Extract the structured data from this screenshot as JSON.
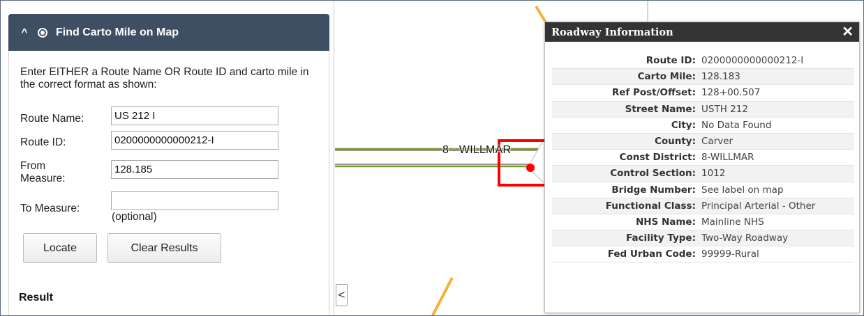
{
  "panel": {
    "title": "Find Carto Mile on Map",
    "instructions": "Enter EITHER a Route Name OR Route ID and carto mile in the correct format as shown:",
    "route_name_label": "Route Name:",
    "route_name_value": "US 212 I",
    "route_id_label": "Route ID:",
    "route_id_value": "0200000000000212-I",
    "from_label": "From Measure:",
    "from_value": "128.185",
    "to_label": "To Measure:",
    "to_value": "",
    "optional_text": "(optional)",
    "locate_label": "Locate",
    "clear_label": "Clear Results",
    "result_title": "Result"
  },
  "map": {
    "road_label": "8 - WILLMAR",
    "collapse_glyph": "<",
    "colors": {
      "route": "#6aa32b",
      "route_inner": "#8d6b6b",
      "highway": "#f3b23a",
      "marker": "#ff0000"
    }
  },
  "popup": {
    "title": "Roadway Information",
    "close_glyph": "✕",
    "rows": [
      {
        "key": "Route ID:",
        "value": "0200000000000212-I"
      },
      {
        "key": "Carto Mile:",
        "value": "128.183"
      },
      {
        "key": "Ref Post/Offset:",
        "value": "128+00.507"
      },
      {
        "key": "Street Name:",
        "value": "USTH 212"
      },
      {
        "key": "City:",
        "value": "No Data Found"
      },
      {
        "key": "County:",
        "value": "Carver"
      },
      {
        "key": "Const District:",
        "value": "8-WILLMAR"
      },
      {
        "key": "Control Section:",
        "value": "1012"
      },
      {
        "key": "Bridge Number:",
        "value": "See label on map"
      },
      {
        "key": "Functional Class:",
        "value": "Principal Arterial - Other"
      },
      {
        "key": "NHS Name:",
        "value": "Mainline NHS"
      },
      {
        "key": "Facility Type:",
        "value": "Two-Way Roadway"
      },
      {
        "key": "Fed Urban Code:",
        "value": "99999-Rural"
      }
    ]
  }
}
